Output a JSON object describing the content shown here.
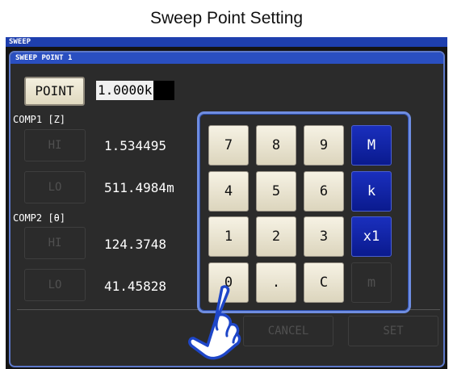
{
  "title": "Sweep Point Setting",
  "screen": {
    "top_bar": "SWEEP",
    "panel_title": "SWEEP POINT 1"
  },
  "point": {
    "button_label": "POINT",
    "value": "1.0000k"
  },
  "comp1": {
    "label": "COMP1 [Z]",
    "hi_label": "HI",
    "hi_value": "1.534495",
    "lo_label": "LO",
    "lo_value": "511.4984m"
  },
  "comp2": {
    "label": "COMP2 [θ]",
    "hi_label": "HI",
    "hi_value": "124.3748",
    "lo_label": "LO",
    "lo_value": "41.45828"
  },
  "keypad": {
    "keys": [
      "7",
      "8",
      "9",
      "M",
      "4",
      "5",
      "6",
      "k",
      "1",
      "2",
      "3",
      "x1",
      "0",
      ".",
      "C",
      "m"
    ]
  },
  "actions": {
    "cancel": "CANCEL",
    "set": "SET"
  },
  "colors": {
    "accent_blue": "#0a1a8e",
    "keypad_border": "#6f8de0",
    "screen_bg": "#141414",
    "header_blue": "#2a4fc0"
  },
  "icons": {
    "pointer": "hand-pointer-icon"
  }
}
